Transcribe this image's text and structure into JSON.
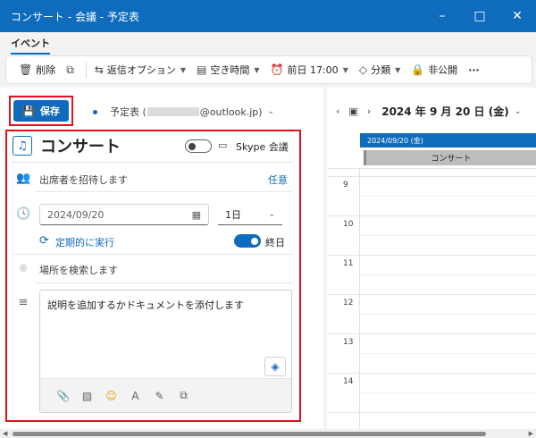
{
  "window": {
    "title": "コンサート - 会議 - 予定表",
    "minimize_icon": "–",
    "maximize_icon": "□",
    "close_icon": "✕"
  },
  "ribbon": {
    "active_tab": "イベント"
  },
  "toolbar": {
    "delete": "削除",
    "reply": "返信オプション",
    "free_busy": "空き時間",
    "reminder": "前日 17:00",
    "category": "分類",
    "private": "非公開",
    "more": "···"
  },
  "header": {
    "save_label": "保存",
    "calendar_prefix": "予定表 (",
    "calendar_suffix": "@outlook.jp)"
  },
  "event": {
    "title": "コンサート",
    "skype_label": "Skype 会議",
    "skype_enabled": false,
    "attendees_placeholder": "出席者を招待します",
    "attendees_link": "任意",
    "start_date": "2024/09/20",
    "duration": "1日",
    "recurring_label": "定期的に実行",
    "all_day_label": "終日",
    "all_day_enabled": true,
    "location_placeholder": "場所を検索します",
    "description_placeholder": "説明を追加するかドキュメントを添付します"
  },
  "calendar": {
    "date_title": "2024 年 9 月 20 日 (金)",
    "day_header": "2024/09/20 (金)",
    "allday_event": "コンサート",
    "hours": [
      "9",
      "10",
      "11",
      "12",
      "13",
      "14"
    ]
  }
}
